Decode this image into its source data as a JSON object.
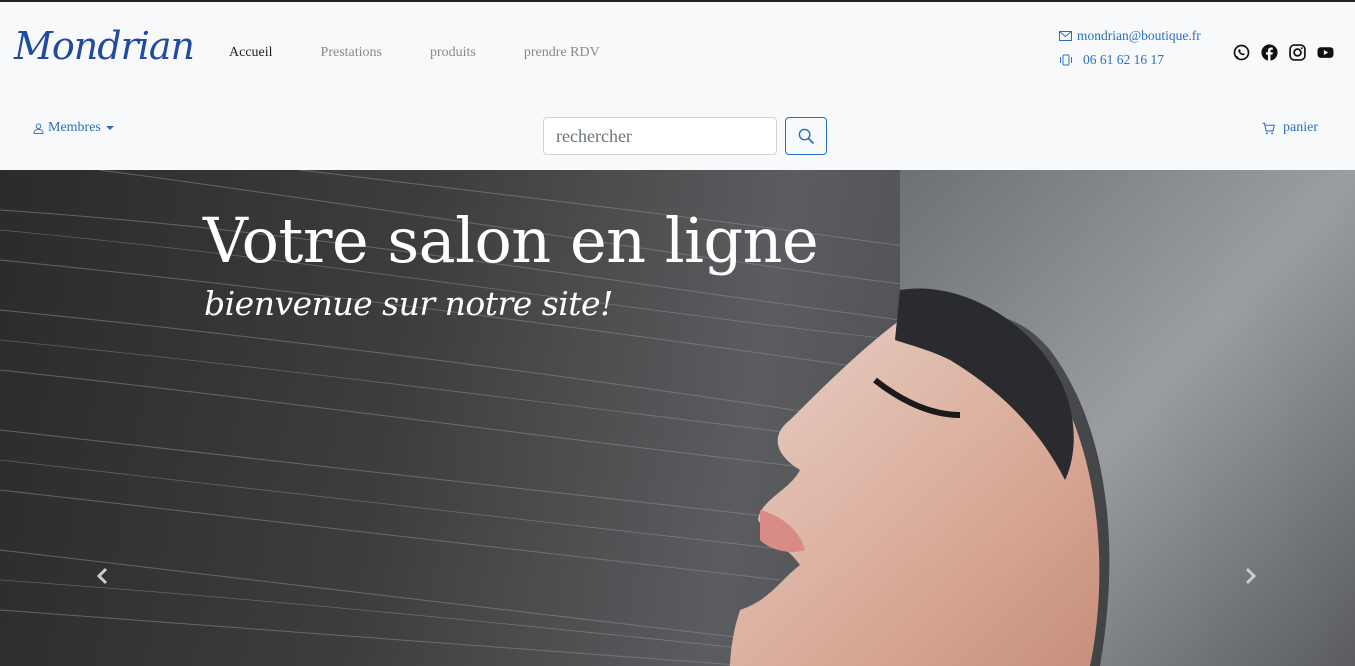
{
  "brand": {
    "logo_text": "Mondrian",
    "color": "#1f4aa0"
  },
  "nav": {
    "items": [
      {
        "label": "Accueil",
        "active": true
      },
      {
        "label": "Prestations",
        "active": false
      },
      {
        "label": "produits",
        "active": false
      },
      {
        "label": "prendre RDV",
        "active": false
      }
    ]
  },
  "contact": {
    "email": "mondrian@boutique.fr",
    "phone": "06 61 62 16 17",
    "email_icon": "envelope-icon",
    "phone_icon": "phone-vibrate-icon"
  },
  "social": [
    "whatsapp-icon",
    "facebook-icon",
    "instagram-icon",
    "youtube-icon"
  ],
  "members": {
    "label": "Membres",
    "icon": "person-icon"
  },
  "search": {
    "placeholder": "rechercher",
    "value": "",
    "button_icon": "search-icon"
  },
  "cart": {
    "label": "panier",
    "icon": "cart-icon"
  },
  "hero": {
    "title": "Votre salon en ligne",
    "subtitle": "bienvenue sur notre site!",
    "prev_icon": "chevron-left-icon",
    "next_icon": "chevron-right-icon"
  },
  "colors": {
    "accent": "#2c6fc0",
    "background": "#f8f9fa"
  }
}
